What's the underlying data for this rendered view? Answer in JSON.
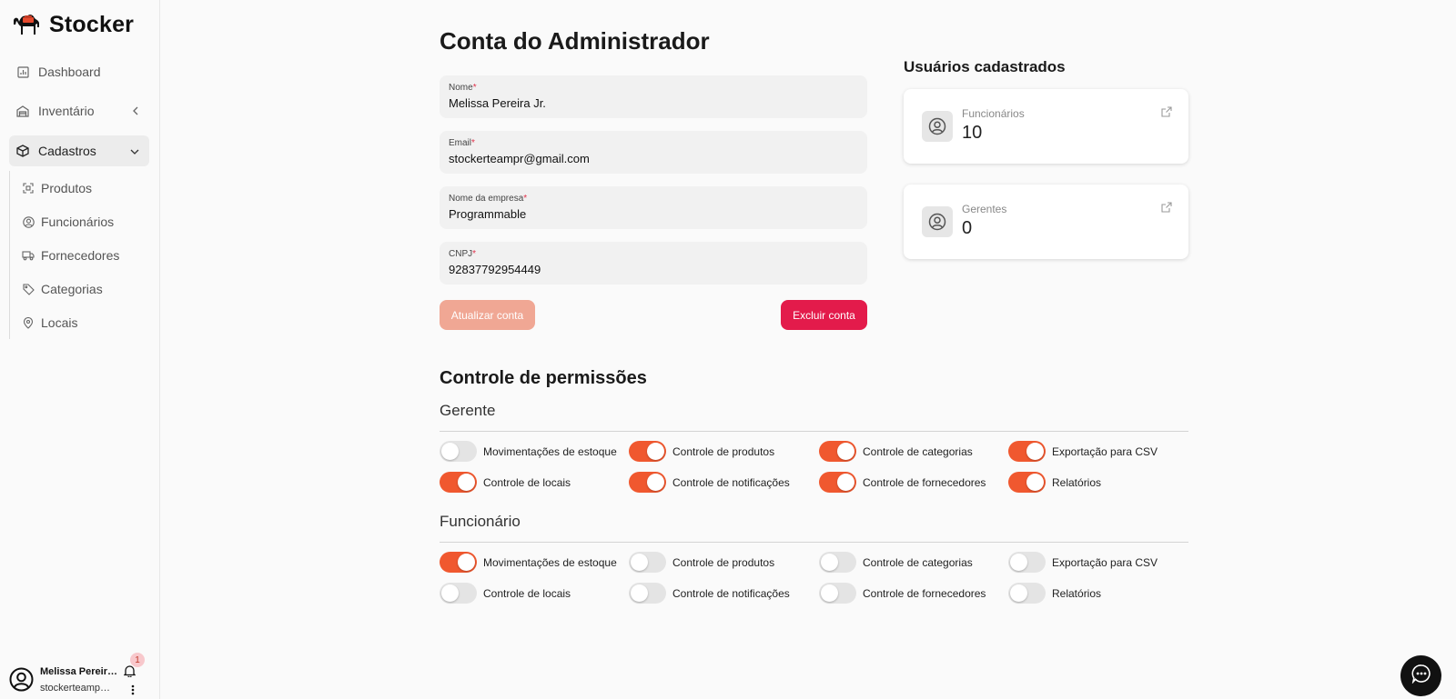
{
  "app": {
    "name": "Stocker"
  },
  "sidebar": {
    "items": [
      {
        "label": "Dashboard",
        "icon": "dashboard-icon"
      },
      {
        "label": "Inventário",
        "icon": "warehouse-icon"
      },
      {
        "label": "Cadastros",
        "icon": "box-icon"
      }
    ],
    "subitems": [
      {
        "label": "Produtos",
        "icon": "scan-icon"
      },
      {
        "label": "Funcionários",
        "icon": "user-circle-icon"
      },
      {
        "label": "Fornecedores",
        "icon": "truck-icon"
      },
      {
        "label": "Categorias",
        "icon": "tag-icon"
      },
      {
        "label": "Locais",
        "icon": "map-pin-icon"
      }
    ]
  },
  "user": {
    "name": "Melissa Pereira Jr.",
    "email": "stockerteampr@gmail.com",
    "notifications": "1"
  },
  "account": {
    "title": "Conta do Administrador",
    "fields": [
      {
        "label": "Nome",
        "value": "Melissa Pereira Jr."
      },
      {
        "label": "Email",
        "value": "stockerteampr@gmail.com"
      },
      {
        "label": "Nome da empresa",
        "value": "Programmable"
      },
      {
        "label": "CNPJ",
        "value": "92837792954449"
      }
    ],
    "update_label": "Atualizar conta",
    "delete_label": "Excluir conta"
  },
  "users_panel": {
    "title": "Usuários cadastrados",
    "cards": [
      {
        "label": "Funcionários",
        "count": "10"
      },
      {
        "label": "Gerentes",
        "count": "0"
      }
    ]
  },
  "permissions": {
    "title": "Controle de permissões",
    "roles": [
      {
        "name": "Gerente",
        "toggles": [
          {
            "label": "Movimentações de estoque",
            "on": false
          },
          {
            "label": "Controle de produtos",
            "on": true
          },
          {
            "label": "Controle de categorias",
            "on": true
          },
          {
            "label": "Exportação para CSV",
            "on": true
          },
          {
            "label": "Controle de locais",
            "on": true
          },
          {
            "label": "Controle de notificações",
            "on": true
          },
          {
            "label": "Controle de fornecedores",
            "on": true
          },
          {
            "label": "Relatórios",
            "on": true
          }
        ]
      },
      {
        "name": "Funcionário",
        "toggles": [
          {
            "label": "Movimentações de estoque",
            "on": true
          },
          {
            "label": "Controle de produtos",
            "on": false
          },
          {
            "label": "Controle de categorias",
            "on": false
          },
          {
            "label": "Exportação para CSV",
            "on": false
          },
          {
            "label": "Controle de locais",
            "on": false
          },
          {
            "label": "Controle de notificações",
            "on": false
          },
          {
            "label": "Controle de fornecedores",
            "on": false
          },
          {
            "label": "Relatórios",
            "on": false
          }
        ]
      }
    ]
  },
  "colors": {
    "accent": "#f0582f",
    "danger": "#e31b4b",
    "disabled_accent": "#f0a794"
  }
}
